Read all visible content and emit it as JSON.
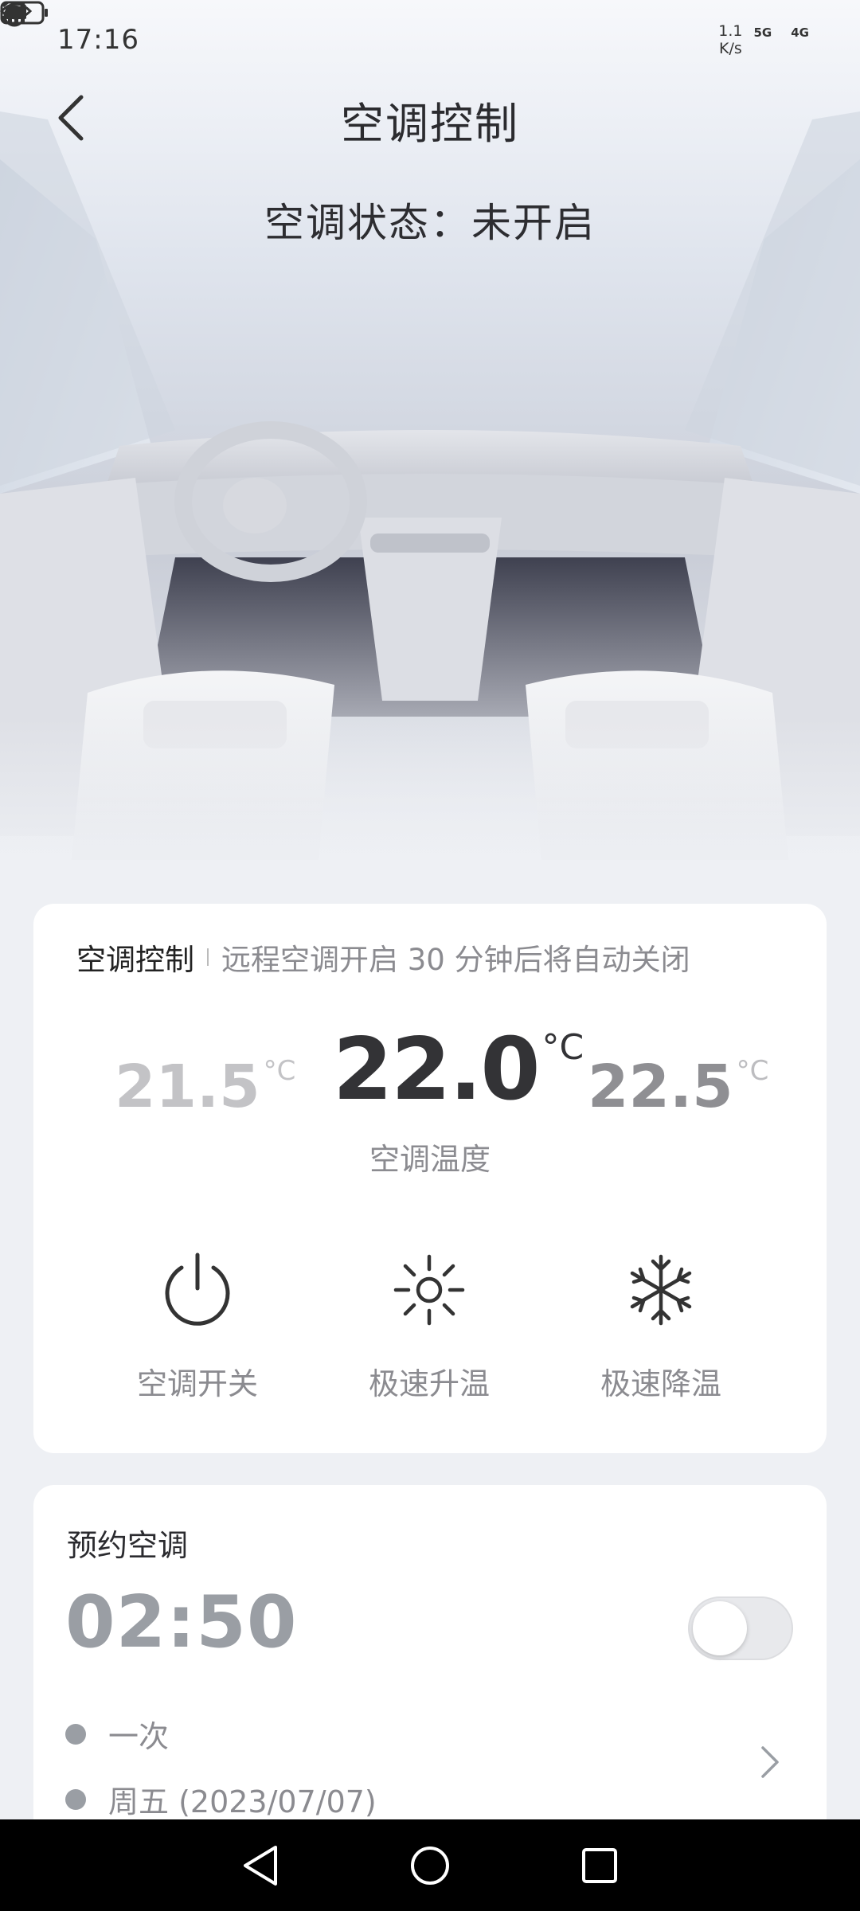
{
  "status_bar": {
    "time": "17:16",
    "net_speed_value": "1.1",
    "net_speed_unit": "K/s",
    "sim1_label": "5G",
    "sim2_label": "4G",
    "icons": [
      "eye-icon",
      "alarm-icon",
      "signal-icon",
      "signal-icon",
      "battery-icon"
    ]
  },
  "header": {
    "title": "空调控制",
    "back_icon": "chevron-left-icon"
  },
  "ac_status": "空调状态：未开启",
  "control_card": {
    "label": "空调控制",
    "hint": "远程空调开启 30 分钟后将自动关闭",
    "temps": {
      "lower": "21.5",
      "current": "22.0",
      "higher": "22.5",
      "unit": "°C"
    },
    "temp_caption": "空调温度",
    "actions": [
      {
        "label": "空调开关",
        "icon": "power-icon"
      },
      {
        "label": "极速升温",
        "icon": "sun-icon"
      },
      {
        "label": "极速降温",
        "icon": "snowflake-icon"
      }
    ]
  },
  "schedule_card": {
    "title": "预约空调",
    "time": "02:50",
    "enabled": false,
    "items": [
      {
        "label": "一次"
      },
      {
        "label": "周五 (2023/07/07)"
      }
    ]
  },
  "navbar": {
    "icons": [
      "nav-back-icon",
      "nav-home-icon",
      "nav-recents-icon"
    ]
  },
  "colors": {
    "background": "#eef0f4",
    "card": "#ffffff",
    "text_primary": "#2f2f33",
    "text_secondary": "#8b8b90",
    "schedule_time": "#9a9ea4",
    "navbar": "#000000"
  }
}
